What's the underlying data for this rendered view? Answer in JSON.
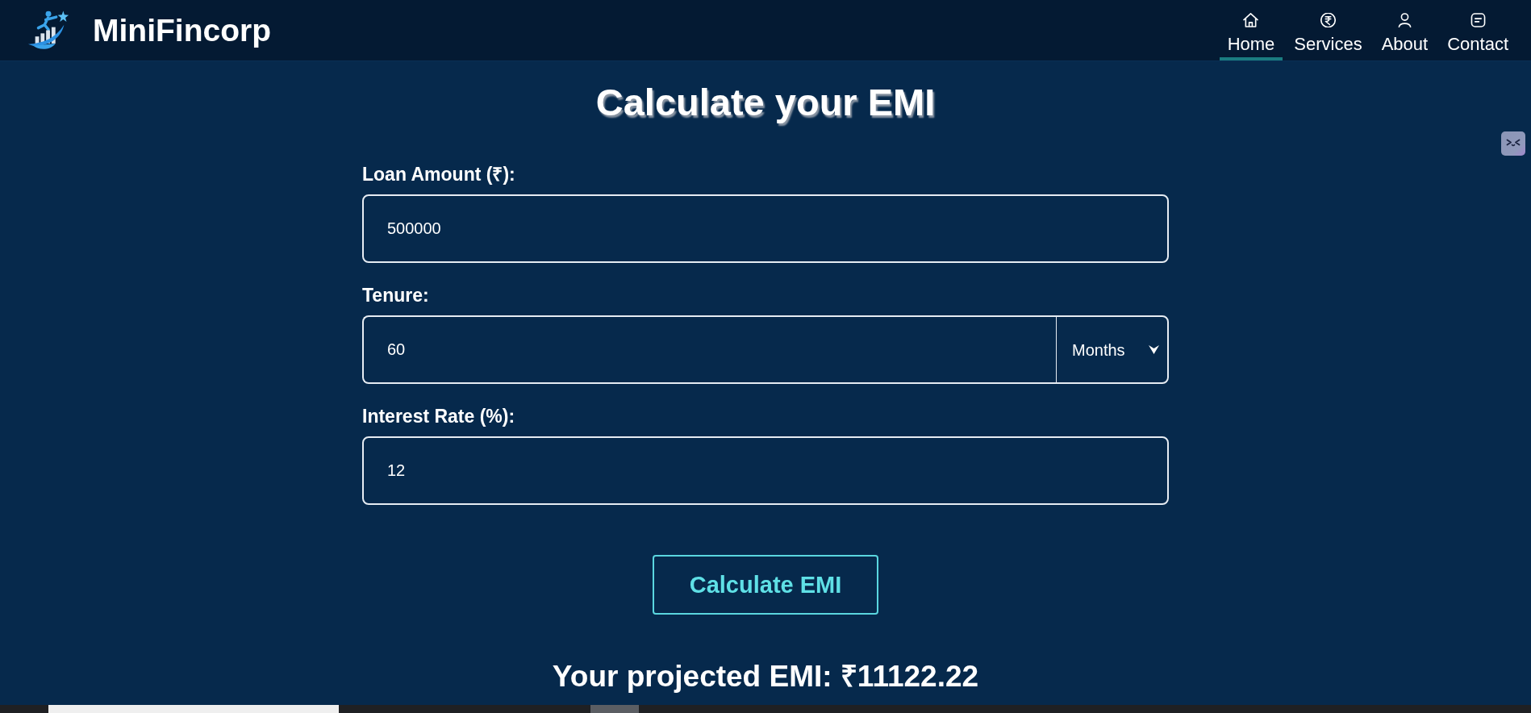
{
  "header": {
    "brand": "MiniFincorp",
    "nav": [
      {
        "label": "Home",
        "selected": true
      },
      {
        "label": "Services",
        "selected": false
      },
      {
        "label": "About",
        "selected": false
      },
      {
        "label": "Contact",
        "selected": false
      }
    ]
  },
  "calculator": {
    "title": "Calculate your EMI",
    "fields": [
      {
        "kind": "plain",
        "label": "Loan Amount (₹):",
        "value": "500000"
      },
      {
        "kind": "unit",
        "label": "Tenure:",
        "value": "60",
        "unit": "Months"
      },
      {
        "kind": "plain",
        "label": "Interest Rate (%):",
        "value": "12"
      }
    ],
    "button": "Calculate EMI",
    "result": "Your projected EMI: ₹11122.22"
  }
}
